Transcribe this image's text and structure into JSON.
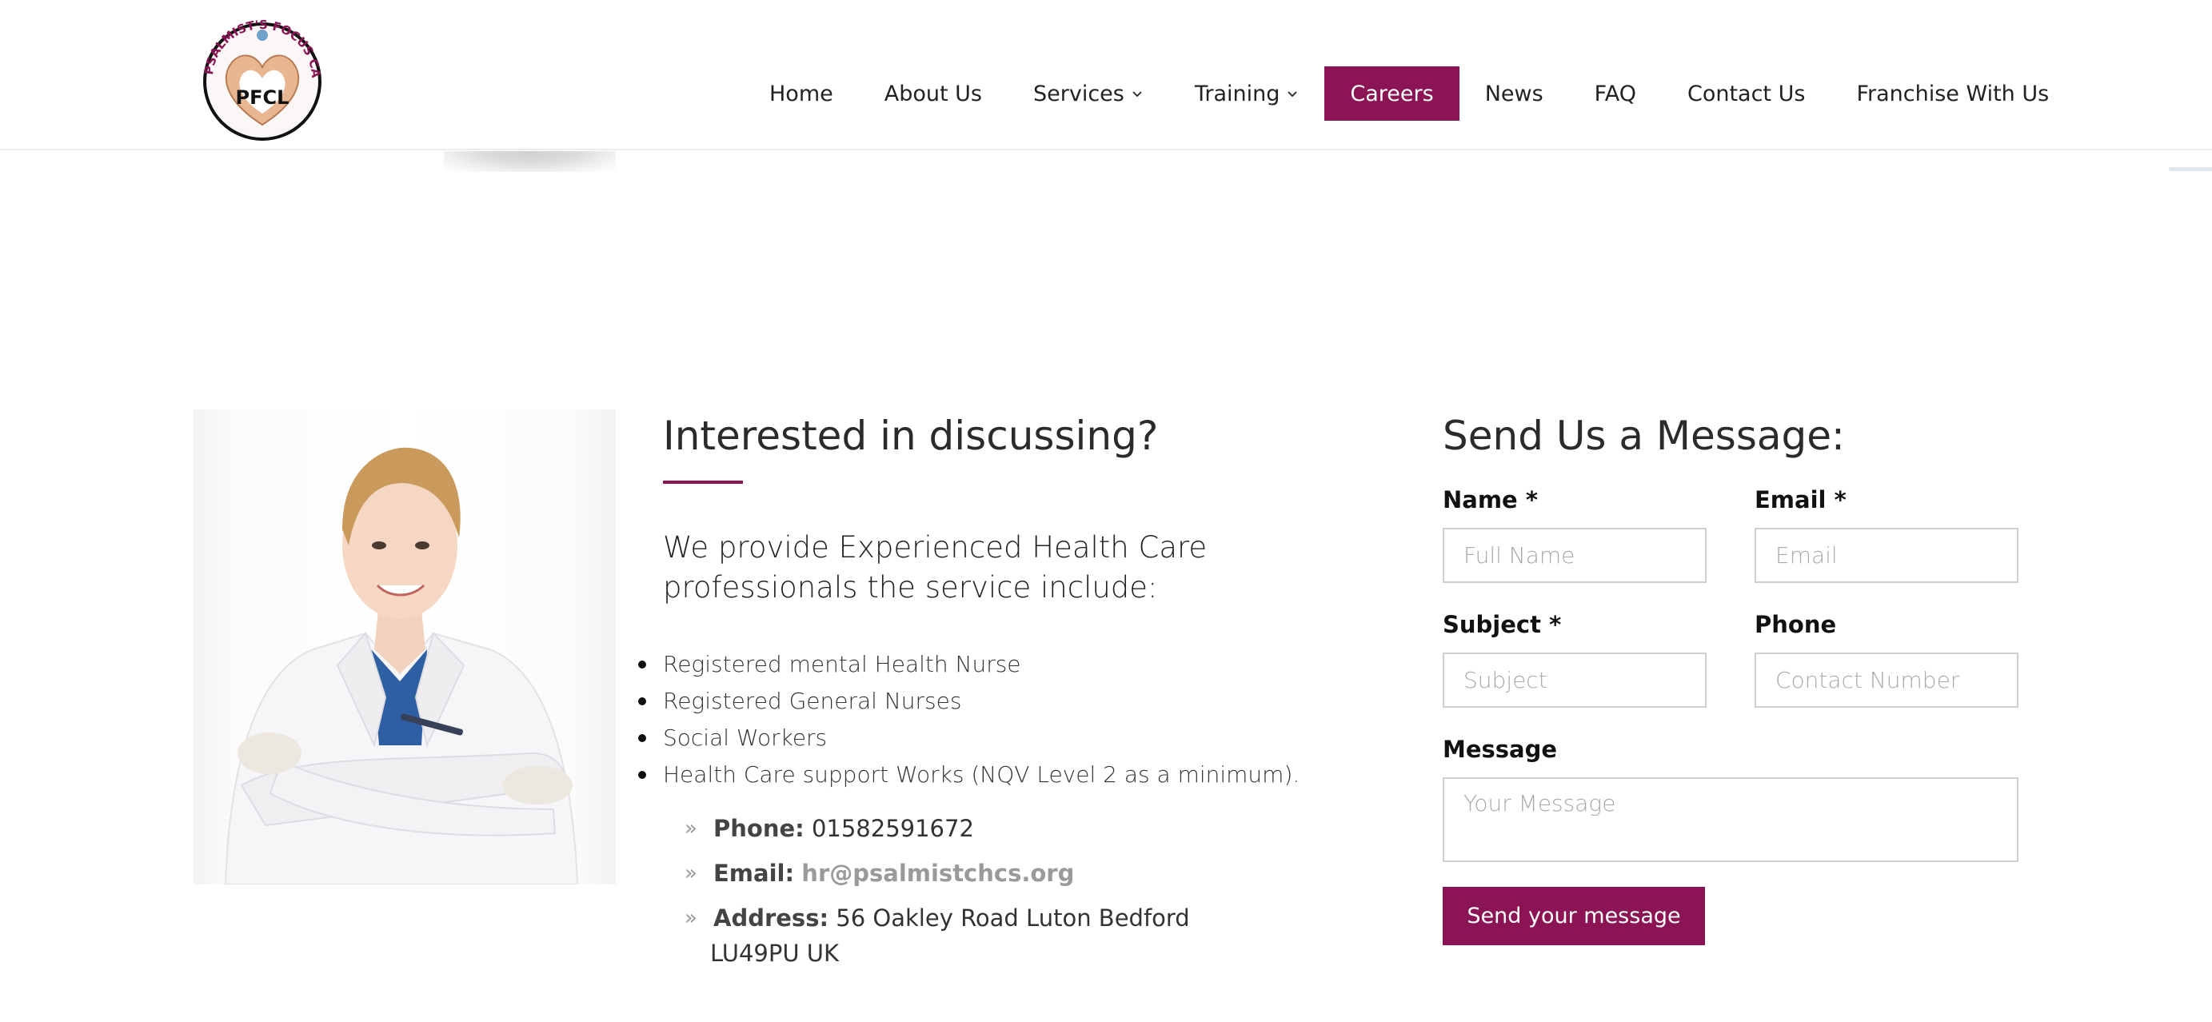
{
  "header": {
    "logo": {
      "ring_text": "PSALMIST'S FOCUS CARE LTD",
      "center_text": "PFCL"
    },
    "nav": [
      {
        "label": "Home"
      },
      {
        "label": "About Us"
      },
      {
        "label": "Services"
      },
      {
        "label": "Training"
      },
      {
        "label": "Careers"
      },
      {
        "label": "News"
      },
      {
        "label": "FAQ"
      },
      {
        "label": "Contact Us"
      },
      {
        "label": "Franchise With Us"
      }
    ],
    "active_nav": "Careers"
  },
  "info": {
    "title": "Interested in discussing?",
    "lead": "We provide Experienced Health Care professionals the service include:",
    "services": [
      "Registered mental Health Nurse",
      "Registered General Nurses",
      "Social Workers",
      "Health Care support Works (NQV Level 2 as a minimum)."
    ],
    "contact": {
      "phone_label": "Phone:",
      "phone": "01582591672",
      "email_label": "Email:",
      "email": "hr@psalmistchcs.org",
      "address_label": "Address:",
      "address_line1": "56 Oakley Road Luton Bedford",
      "address_line2": "LU49PU UK"
    }
  },
  "form": {
    "title": "Send Us a Message:",
    "required_mark": "*",
    "name": {
      "label": "Name",
      "placeholder": "Full Name"
    },
    "email": {
      "label": "Email",
      "placeholder": "Email"
    },
    "subject": {
      "label": "Subject",
      "placeholder": "Subject"
    },
    "phone": {
      "label": "Phone",
      "placeholder": "Contact Number"
    },
    "message": {
      "label": "Message",
      "placeholder": "Your Message"
    },
    "submit_label": "Send your message"
  },
  "colors": {
    "brand": "#8b1455",
    "text": "#222222",
    "border": "#cfcfcf"
  }
}
